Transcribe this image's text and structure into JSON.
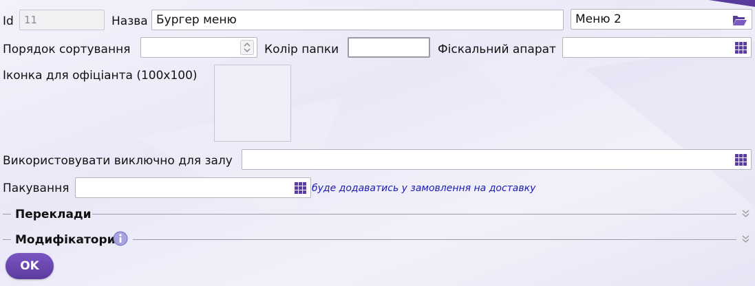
{
  "fields": {
    "id": {
      "label": "Id",
      "value": "11"
    },
    "name": {
      "label": "Назва",
      "value": "Бургер меню"
    },
    "menu": {
      "value": "Меню 2",
      "icon": "folder-open-icon"
    },
    "sort_order": {
      "label": "Порядок сортування",
      "value": ""
    },
    "folder_color": {
      "label": "Колір папки"
    },
    "fiscal": {
      "label": "Фіскальний апарат",
      "value": ""
    },
    "waiter_icon": {
      "label": "Іконка для офіціанта (100x100)"
    },
    "hall": {
      "label": "Використовувати виключно для залу",
      "value": ""
    },
    "packing": {
      "label": "Пакування",
      "value": "",
      "hint": "буде додаватись у замовлення на доставку"
    }
  },
  "sections": {
    "translations": {
      "label": "Переклади"
    },
    "modifiers": {
      "label": "Модифікатори",
      "icon": "info-icon"
    }
  },
  "buttons": {
    "ok": "OK"
  },
  "colors": {
    "accent": "#5b3a9e",
    "hint": "#1a1ab4",
    "border": "#b4b4bc"
  }
}
